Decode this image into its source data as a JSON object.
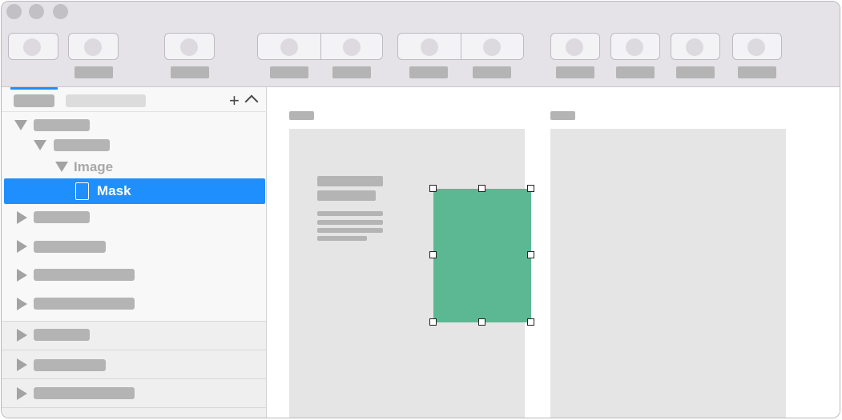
{
  "layers": {
    "image_label": "Image",
    "mask_label": "Mask"
  },
  "icons": {
    "add": "+",
    "collapse": "chevron-up-icon",
    "mask": "mask-icon",
    "disclosure_open": "triangle-down-icon",
    "disclosure_closed": "triangle-right-icon"
  },
  "colors": {
    "selection": "#1f8ffd",
    "shape_fill": "#5bb893",
    "toolbar_bg": "#e5e3e7",
    "artboard_bg": "#e5e5e5",
    "placeholder": "#b4b4b4"
  }
}
